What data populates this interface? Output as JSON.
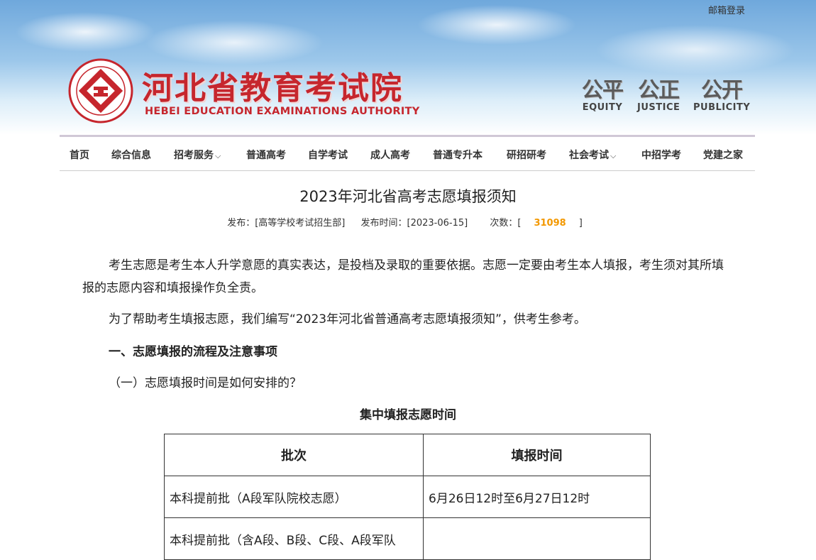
{
  "top_link": "邮箱登录",
  "logo": {
    "title_cn": "河北省教育考试院",
    "title_en": "HEBEI EDUCATION EXAMINATIONS AUTHORITY"
  },
  "motto": [
    {
      "cn": "公平",
      "en": "EQUITY"
    },
    {
      "cn": "公正",
      "en": "JUSTICE"
    },
    {
      "cn": "公开",
      "en": "PUBLICITY"
    }
  ],
  "nav": [
    {
      "label": "首页"
    },
    {
      "label": "综合信息"
    },
    {
      "label": "招考服务",
      "dropdown": true
    },
    {
      "label": "普通高考"
    },
    {
      "label": "自学考试"
    },
    {
      "label": "成人高考"
    },
    {
      "label": "普通专升本"
    },
    {
      "label": "研招研考"
    },
    {
      "label": "社会考试",
      "dropdown": true
    },
    {
      "label": "中招学考"
    },
    {
      "label": "党建之家"
    }
  ],
  "article": {
    "title": "2023年河北省高考志愿填报须知",
    "meta": {
      "publisher": "发布：[高等学校考试招生部]",
      "time": "发布时间：[2023-06-15]",
      "count_prefix": "次数：[",
      "count": "31098",
      "count_suffix": "]"
    },
    "para1": "考生志愿是考生本人升学意愿的真实表达，是投档及录取的重要依据。志愿一定要由考生本人填报，考生须对其所填报的志愿内容和填报操作负全责。",
    "para2": "为了帮助考生填报志愿，我们编写“2023年河北省普通高考志愿填报须知”，供考生参考。",
    "heading1": "一、志愿填报的流程及注意事项",
    "heading2": "（一）志愿填报时间是如何安排的？",
    "table_title": "集中填报志愿时间",
    "table": {
      "headers": [
        "批次",
        "填报时间"
      ],
      "rows": [
        [
          "本科提前批（A段军队院校志愿）",
          "6月26日12时至6月27日12时"
        ],
        [
          "本科提前批（含A段、B段、C段、A段军队",
          ""
        ]
      ]
    }
  }
}
